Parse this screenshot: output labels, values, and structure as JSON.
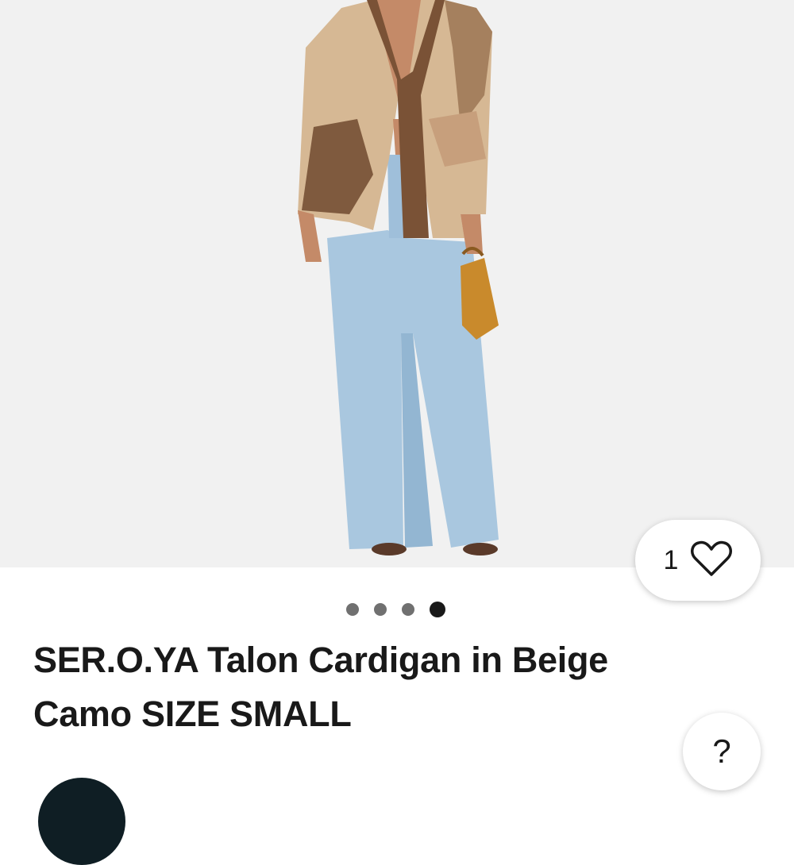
{
  "gallery": {
    "favorite_count": "1",
    "dots_total": 4,
    "active_dot": 4
  },
  "listing": {
    "title": "SER.O.YA Talon Cardigan in Beige Camo SIZE SMALL"
  },
  "help": {
    "label": "?"
  },
  "icons": {
    "favorite": "heart-outline-icon",
    "help": "question-mark-icon"
  }
}
